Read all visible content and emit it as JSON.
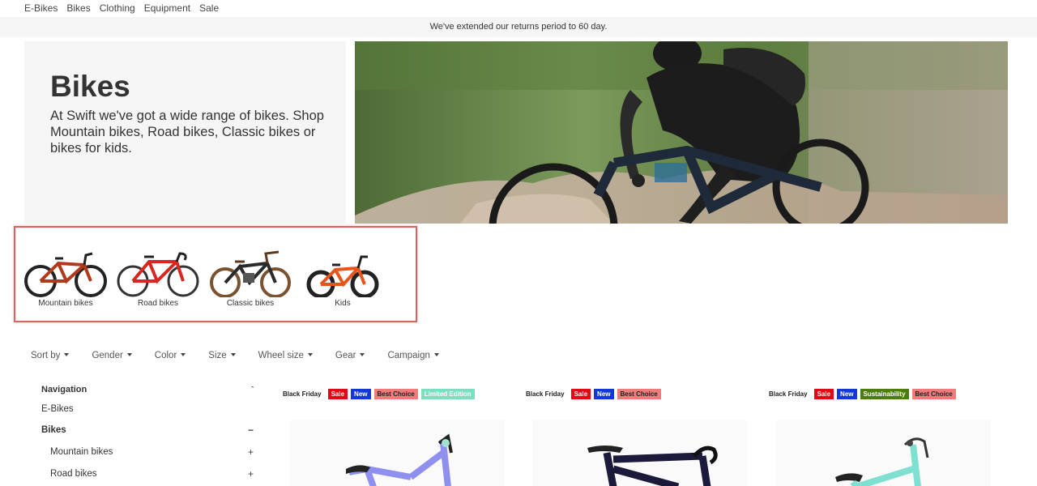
{
  "topnav": {
    "items": [
      "E-Bikes",
      "Bikes",
      "Clothing",
      "Equipment",
      "Sale"
    ]
  },
  "announcement": {
    "text": "We've extended our returns period to 60 day."
  },
  "hero": {
    "title": "Bikes",
    "description": "At Swift we've got a wide range of bikes. Shop Mountain bikes, Road bikes, Classic bikes or bikes for kids."
  },
  "categories": [
    {
      "label": "Mountain bikes",
      "color": "#b23a1c"
    },
    {
      "label": "Road bikes",
      "color": "#d8271f"
    },
    {
      "label": "Classic bikes",
      "color": "#2a2a2a"
    },
    {
      "label": "Kids",
      "color": "#e8541a"
    }
  ],
  "filters": [
    "Sort by",
    "Gender",
    "Color",
    "Size",
    "Wheel size",
    "Gear",
    "Campaign"
  ],
  "sidenav": {
    "heading": "Navigation",
    "heading_icon": "chevron-up-icon",
    "items": [
      {
        "label": "E-Bikes",
        "sign": ""
      },
      {
        "label": "Bikes",
        "sign": "−"
      },
      {
        "label": "Mountain bikes",
        "sign": "+"
      },
      {
        "label": "Road bikes",
        "sign": "+"
      }
    ]
  },
  "products": [
    {
      "tags": [
        "Black Friday",
        "Sale",
        "New",
        "Best Choice",
        "Limited Edition"
      ],
      "bike_color": "#8f8ff0"
    },
    {
      "tags": [
        "Black Friday",
        "Sale",
        "New",
        "Best Choice"
      ],
      "bike_color": "#1c1a3a"
    },
    {
      "tags": [
        "Black Friday",
        "Sale",
        "New",
        "Sustainability",
        "Best Choice"
      ],
      "bike_color": "#7fe0d2"
    }
  ]
}
